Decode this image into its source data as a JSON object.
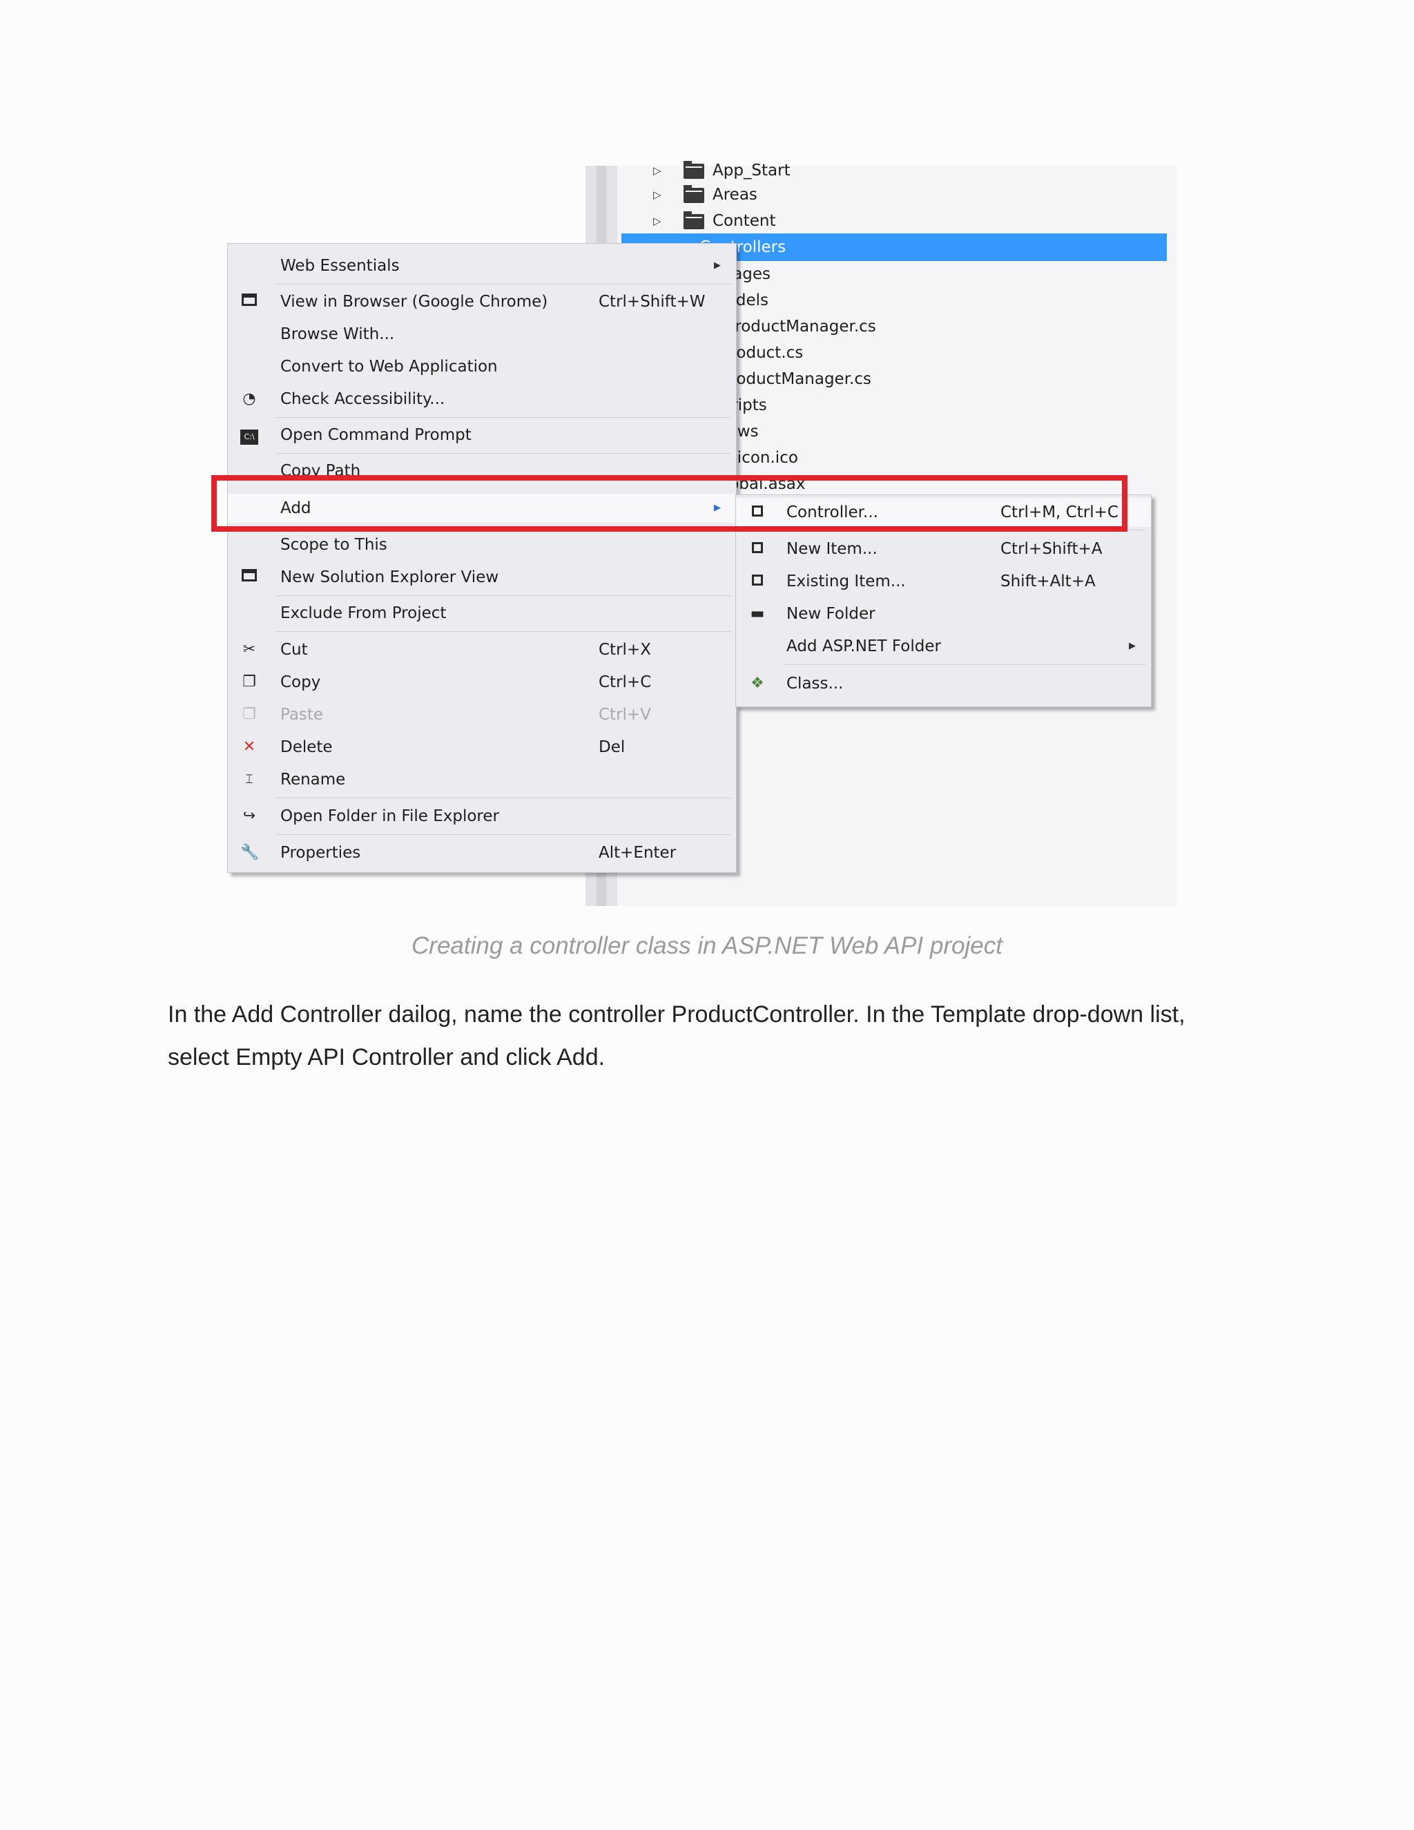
{
  "explorer": {
    "items": [
      {
        "label": "App_Start"
      },
      {
        "label": "Areas"
      },
      {
        "label": "Content"
      },
      {
        "label": "Controllers",
        "selected": true
      },
      {
        "label": "Images"
      },
      {
        "label": "Models"
      },
      {
        "label": "IProductManager.cs"
      },
      {
        "label": "Product.cs"
      },
      {
        "label": "ProductManager.cs"
      },
      {
        "label": "Scripts"
      },
      {
        "label": "Views"
      },
      {
        "label": "favicon.ico"
      },
      {
        "label": "Global.asax"
      }
    ]
  },
  "context_menu": {
    "items": [
      {
        "label": "Web Essentials",
        "submenu": true
      },
      {
        "label": "View in Browser (Google Chrome)",
        "shortcut": "Ctrl+Shift+W",
        "icon": "browser-icon"
      },
      {
        "label": "Browse With..."
      },
      {
        "label": "Convert to Web Application"
      },
      {
        "label": "Check Accessibility...",
        "icon": "accessibility-icon"
      },
      {
        "label": "Open Command Prompt",
        "icon": "command-prompt-icon"
      },
      {
        "label": "Copy Path"
      },
      {
        "label": "Add",
        "submenu": true
      },
      {
        "label": "Scope to This"
      },
      {
        "label": "New Solution Explorer View",
        "icon": "solution-explorer-icon"
      },
      {
        "label": "Exclude From Project"
      },
      {
        "label": "Cut",
        "shortcut": "Ctrl+X",
        "icon": "scissors-icon"
      },
      {
        "label": "Copy",
        "shortcut": "Ctrl+C",
        "icon": "copy-icon"
      },
      {
        "label": "Paste",
        "shortcut": "Ctrl+V",
        "icon": "paste-icon",
        "disabled": true
      },
      {
        "label": "Delete",
        "shortcut": "Del",
        "icon": "delete-icon"
      },
      {
        "label": "Rename",
        "icon": "rename-icon"
      },
      {
        "label": "Open Folder in File Explorer",
        "icon": "open-folder-icon"
      },
      {
        "label": "Properties",
        "shortcut": "Alt+Enter",
        "icon": "wrench-icon"
      }
    ]
  },
  "add_submenu": {
    "items": [
      {
        "label": "Controller...",
        "shortcut": "Ctrl+M, Ctrl+C",
        "icon": "controller-icon"
      },
      {
        "label": "New Item...",
        "shortcut": "Ctrl+Shift+A",
        "icon": "new-item-icon"
      },
      {
        "label": "Existing Item...",
        "shortcut": "Shift+Alt+A",
        "icon": "existing-item-icon"
      },
      {
        "label": "New Folder",
        "icon": "new-folder-icon"
      },
      {
        "label": "Add ASP.NET Folder",
        "submenu": true
      },
      {
        "label": "Class...",
        "icon": "class-icon"
      }
    ]
  },
  "colors": {
    "selection": "#3399ff",
    "annotation": "#e3232b",
    "delete_icon": "#d9332b"
  },
  "caption": "Creating a controller class in ASP.NET Web API project",
  "body": {
    "line1": "In the Add Controller dailog, name the controller ProductController. In the Template drop-down list,",
    "line2": "select Empty API Controller and click Add."
  }
}
